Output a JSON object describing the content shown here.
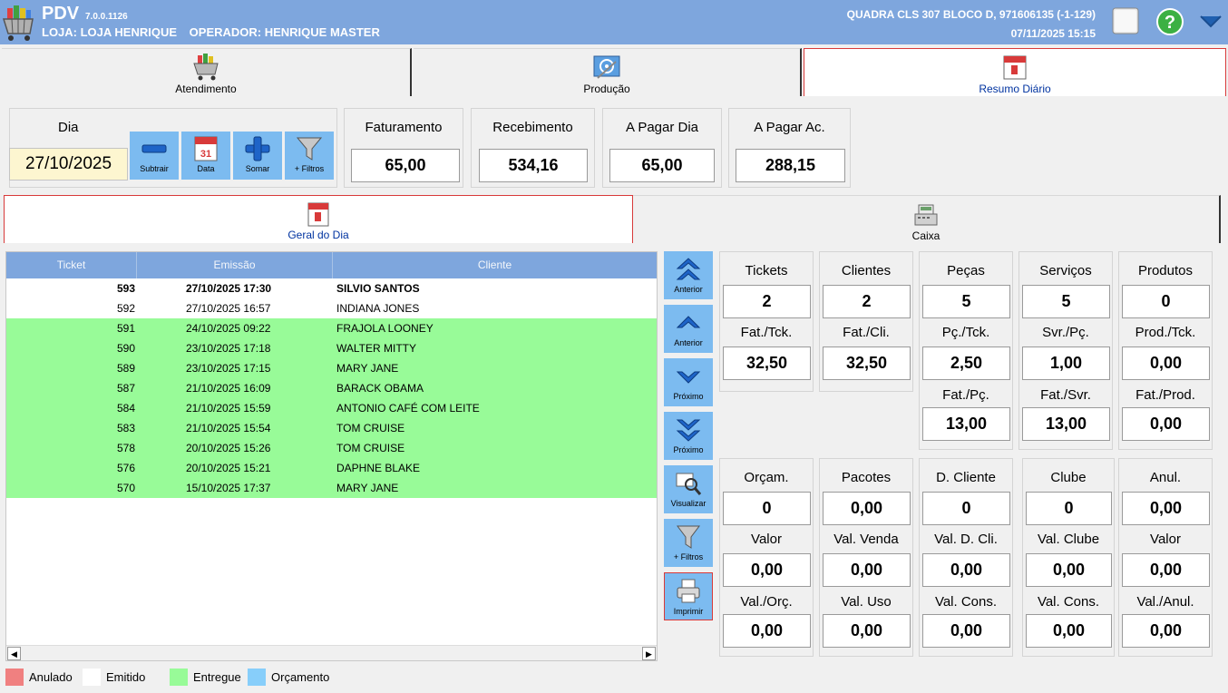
{
  "header": {
    "app_name": "PDV",
    "version": "7.0.0.1126",
    "store": "LOJA: LOJA HENRIQUE",
    "operator": "OPERADOR: HENRIQUE MASTER",
    "address": "QUADRA CLS 307 BLOCO D, 971606135 (-1-129)",
    "datetime": "07/11/2025 15:15"
  },
  "tabs": {
    "atendimento": "Atendimento",
    "producao": "Produção",
    "resumo": "Resumo Diário"
  },
  "filters": {
    "dia_label": "Dia",
    "dia_value": "27/10/2025",
    "subtrair": "Subtrair",
    "data": "Data",
    "somar": "Somar",
    "mais_filtros": "+ Filtros"
  },
  "summary": {
    "faturamento": {
      "label": "Faturamento",
      "value": "65,00"
    },
    "recebimento": {
      "label": "Recebimento",
      "value": "534,16"
    },
    "a_pagar_dia": {
      "label": "A Pagar Dia",
      "value": "65,00"
    },
    "a_pagar_ac": {
      "label": "A Pagar Ac.",
      "value": "288,15"
    }
  },
  "subtabs": {
    "geral": "Geral do Dia",
    "caixa": "Caixa"
  },
  "table": {
    "headers": [
      "Ticket",
      "Emissão",
      "Cliente"
    ],
    "rows": [
      {
        "ticket": "593",
        "emissao": "27/10/2025 17:30",
        "cliente": "SILVIO SANTOS"
      },
      {
        "ticket": "592",
        "emissao": "27/10/2025 16:57",
        "cliente": "INDIANA JONES"
      },
      {
        "ticket": "591",
        "emissao": "24/10/2025 09:22",
        "cliente": "FRAJOLA LOONEY"
      },
      {
        "ticket": "590",
        "emissao": "23/10/2025 17:18",
        "cliente": "WALTER MITTY"
      },
      {
        "ticket": "589",
        "emissao": "23/10/2025 17:15",
        "cliente": "MARY JANE"
      },
      {
        "ticket": "587",
        "emissao": "21/10/2025 16:09",
        "cliente": "BARACK OBAMA"
      },
      {
        "ticket": "584",
        "emissao": "21/10/2025 15:59",
        "cliente": "ANTONIO CAFÉ COM LEITE"
      },
      {
        "ticket": "583",
        "emissao": "21/10/2025 15:54",
        "cliente": "TOM CRUISE"
      },
      {
        "ticket": "578",
        "emissao": "20/10/2025 15:26",
        "cliente": "TOM CRUISE"
      },
      {
        "ticket": "576",
        "emissao": "20/10/2025 15:21",
        "cliente": "DAPHNE BLAKE"
      },
      {
        "ticket": "570",
        "emissao": "15/10/2025 17:37",
        "cliente": "MARY JANE"
      }
    ]
  },
  "side_buttons": {
    "anterior_page": "Anterior",
    "anterior": "Anterior",
    "proximo": "Próximo",
    "proximo_page": "Próximo",
    "visualizar": "Visualizar",
    "mais_filtros": "+ Filtros",
    "imprimir": "Imprimir"
  },
  "stats": {
    "tickets": {
      "label": "Tickets",
      "value": "2",
      "sub_label": "Fat./Tck.",
      "sub_value": "32,50"
    },
    "clientes": {
      "label": "Clientes",
      "value": "2",
      "sub_label": "Fat./Cli.",
      "sub_value": "32,50"
    },
    "pecas": {
      "label": "Peças",
      "value": "5",
      "sub_label": "Pç./Tck.",
      "sub_value": "2,50",
      "sub2_label": "Fat./Pç.",
      "sub2_value": "13,00"
    },
    "servicos": {
      "label": "Serviços",
      "value": "5",
      "sub_label": "Svr./Pç.",
      "sub_value": "1,00",
      "sub2_label": "Fat./Svr.",
      "sub2_value": "13,00"
    },
    "produtos": {
      "label": "Produtos",
      "value": "0",
      "sub_label": "Prod./Tck.",
      "sub_value": "0,00",
      "sub2_label": "Fat./Prod.",
      "sub2_value": "0,00"
    },
    "orcam": {
      "label": "Orçam.",
      "value": "0",
      "sub_label": "Valor",
      "sub_value": "0,00",
      "sub2_label": "Val./Orç.",
      "sub2_value": "0,00"
    },
    "pacotes": {
      "label": "Pacotes",
      "value": "0,00",
      "sub_label": "Val. Venda",
      "sub_value": "0,00",
      "sub2_label": "Val. Uso",
      "sub2_value": "0,00"
    },
    "d_cliente": {
      "label": "D. Cliente",
      "value": "0",
      "sub_label": "Val. D. Cli.",
      "sub_value": "0,00",
      "sub2_label": "Val. Cons.",
      "sub2_value": "0,00"
    },
    "clube": {
      "label": "Clube",
      "value": "0",
      "sub_label": "Val. Clube",
      "sub_value": "0,00",
      "sub2_label": "Val. Cons.",
      "sub2_value": "0,00"
    },
    "anul": {
      "label": "Anul.",
      "value": "0,00",
      "sub_label": "Valor",
      "sub_value": "0,00",
      "sub2_label": "Val./Anul.",
      "sub2_value": "0,00"
    }
  },
  "legend": {
    "anulado": {
      "label": "Anulado",
      "color": "#f08080"
    },
    "emitido": {
      "label": "Emitido",
      "color": "#ffffff"
    },
    "entregue": {
      "label": "Entregue",
      "color": "#98fb98"
    },
    "orcamento": {
      "label": "Orçamento",
      "color": "#87cefa"
    }
  },
  "colors": {
    "header": "#7ea6dd",
    "button": "#7cbbf0",
    "entregue_row": "#98fb98",
    "active_tab_text": "#0033a0"
  }
}
